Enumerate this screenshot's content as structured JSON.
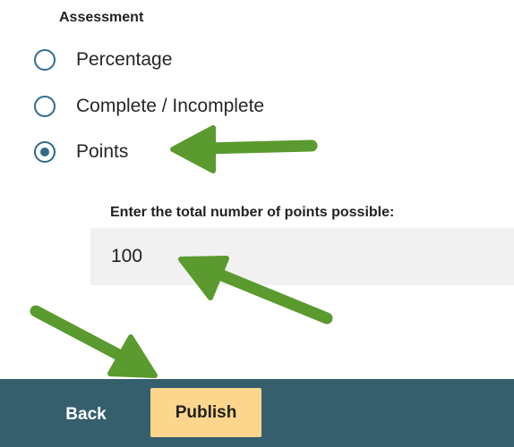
{
  "assessment": {
    "title": "Assessment",
    "options": [
      {
        "label": "Percentage",
        "selected": false
      },
      {
        "label": "Complete / Incomplete",
        "selected": false
      },
      {
        "label": "Points",
        "selected": true
      }
    ]
  },
  "points_field": {
    "label": "Enter the total number of points possible:",
    "value": "100"
  },
  "footer": {
    "back_label": "Back",
    "publish_label": "Publish"
  },
  "colors": {
    "radio_accent": "#2f6b8f",
    "footer_bg": "#365f6e",
    "publish_bg": "#fbd68c",
    "input_bg": "#f1f1f1",
    "annotation_arrow": "#5a9a2e"
  }
}
